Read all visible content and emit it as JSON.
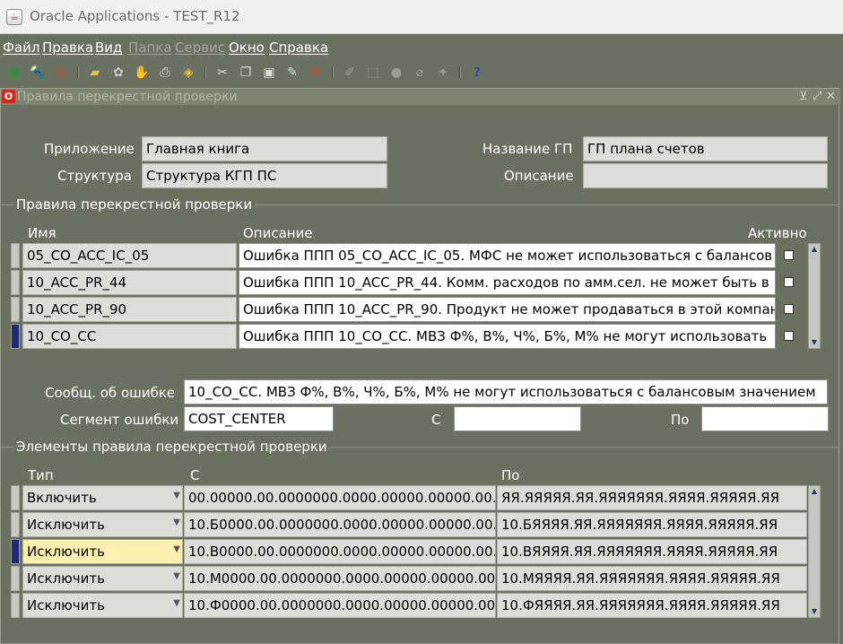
{
  "window": {
    "title": "Oracle Applications - TEST_R12"
  },
  "menu": [
    {
      "label": "Файл",
      "enabled": true
    },
    {
      "label": "Правка",
      "enabled": true
    },
    {
      "label": "Вид",
      "enabled": true
    },
    {
      "label": "Папка",
      "enabled": false
    },
    {
      "label": "Сервис",
      "enabled": false
    },
    {
      "label": "Окно",
      "enabled": true
    },
    {
      "label": "Справка",
      "enabled": true
    }
  ],
  "form": {
    "title": "Правила перекрестной проверки",
    "header": {
      "app_label": "Приложение",
      "app_value": "Главная книга",
      "structure_label": "Структура",
      "structure_value": "Структура КГП ПС",
      "ledger_label": "Название ГП",
      "ledger_value": "ГП плана счетов",
      "desc_label": "Описание",
      "desc_value": ""
    },
    "rules_section": {
      "title": "Правила перекрестной проверки",
      "col_name": "Имя",
      "col_desc": "Описание",
      "col_active": "Активно",
      "rows": [
        {
          "name": "05_CO_ACC_IC_05",
          "desc": "Ошибка ППП 05_CO_ACC_IC_05. МФС не может использоваться с балансов",
          "active": false
        },
        {
          "name": "10_ACC_PR_44",
          "desc": "Ошибка ППП 10_ACC_PR_44. Комм. расходов по амм.сел. не может быть в 1",
          "active": false
        },
        {
          "name": "10_ACC_PR_90",
          "desc": "Ошибка ППП 10_ACC_PR_90. Продукт не может продаваться в этой компани",
          "active": false
        },
        {
          "name": "10_CO_CC",
          "desc": "Ошибка ППП 10_CO_CC. МВЗ Ф%, В%, Ч%, Б%, М% не могут использовать",
          "active": false
        }
      ]
    },
    "error": {
      "msg_label": "Сообщ. об ошибке",
      "msg_value": "10_CO_CC. МВЗ Ф%, В%, Ч%, Б%, М% не могут использоваться с балансовым значением",
      "segment_label": "Сегмент ошибки",
      "segment_value": "COST_CENTER",
      "from_label": "С",
      "from_value": "",
      "to_label": "По",
      "to_value": ""
    },
    "elements_section": {
      "title": "Элементы правила перекрестной проверки",
      "col_type": "Тип",
      "col_from": "С",
      "col_to": "По",
      "rows": [
        {
          "type": "Включить",
          "from": "00.00000.00.0000000.0000.00000.00000.00.00",
          "to": "ЯЯ.ЯЯЯЯЯ.ЯЯ.ЯЯЯЯЯЯЯ.ЯЯЯЯ.ЯЯЯЯЯ.ЯЯ"
        },
        {
          "type": "Исключить",
          "from": "10.Б0000.00.0000000.0000.00000.00000.00.00",
          "to": "10.БЯЯЯЯ.ЯЯ.ЯЯЯЯЯЯЯ.ЯЯЯЯ.ЯЯЯЯЯ.ЯЯ"
        },
        {
          "type": "Исключить",
          "from": "10.В0000.00.0000000.0000.00000.00000.00.00",
          "to": "10.ВЯЯЯЯ.ЯЯ.ЯЯЯЯЯЯЯ.ЯЯЯЯ.ЯЯЯЯЯ.ЯЯ"
        },
        {
          "type": "Исключить",
          "from": "10.М0000.00.0000000.0000.00000.00000.00.00",
          "to": "10.МЯЯЯЯ.ЯЯ.ЯЯЯЯЯЯЯ.ЯЯЯЯ.ЯЯЯЯЯ.ЯЯ"
        },
        {
          "type": "Исключить",
          "from": "10.Ф0000.00.0000000.0000.00000.00000.00.00",
          "to": "10.ФЯЯЯЯ.ЯЯ.ЯЯЯЯЯЯЯ.ЯЯЯЯ.ЯЯЯЯЯ.ЯЯ"
        }
      ]
    }
  },
  "toolbar_icons": [
    "new-icon",
    "find-icon",
    "navigator-icon",
    "save-icon",
    "next-step-icon",
    "switch-responsibility-icon",
    "print-icon",
    "close-form-icon",
    "cut-icon",
    "copy-icon",
    "paste-icon",
    "new-record-icon",
    "delete-record-icon",
    "edit-field-icon",
    "zoom-icon",
    "translations-icon",
    "attachments-icon",
    "folder-tools-icon",
    "help-icon"
  ],
  "colors": {
    "background": "#6b7160",
    "field": "#dedcd8",
    "current_field": "#fef1b0",
    "current_indicator": "#1c2a7a",
    "logo_red": "#d7271d"
  }
}
